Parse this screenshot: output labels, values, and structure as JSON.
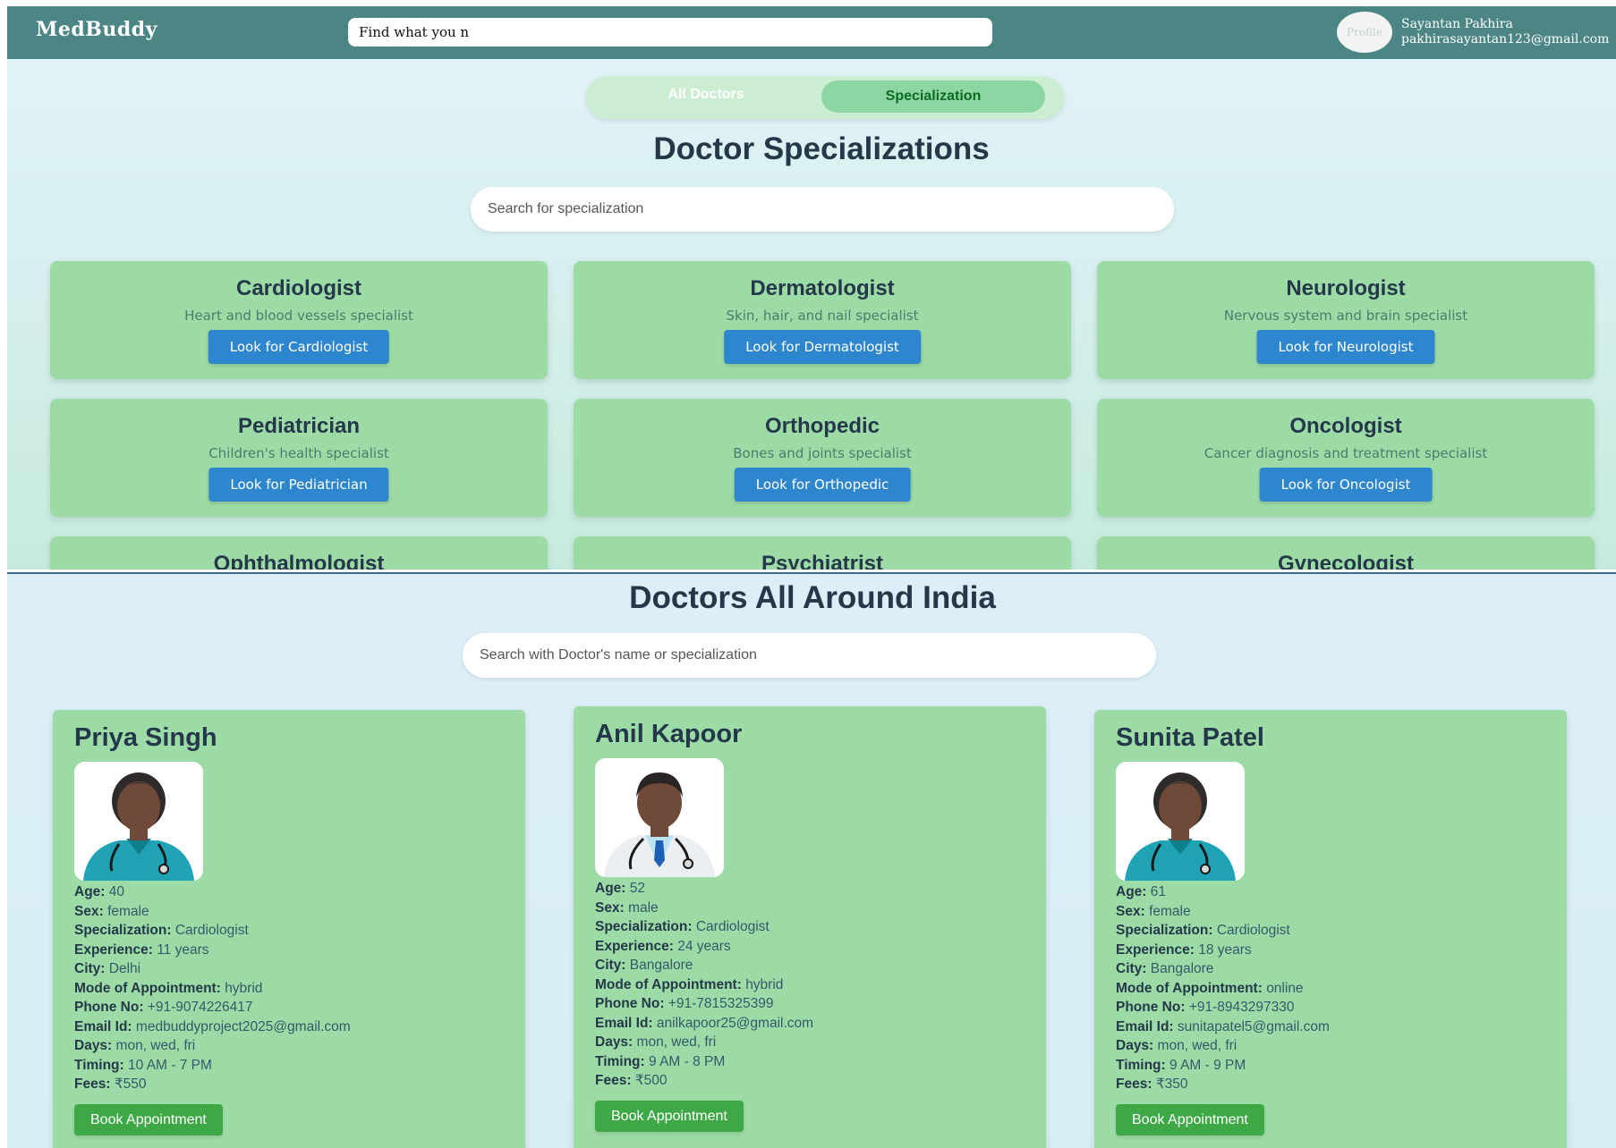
{
  "navbar": {
    "brand": "MedBuddy",
    "search_value": "Find what you n",
    "avatar_alt": "Profile",
    "user_name": "Sayantan Pakhira",
    "user_email": "pakhirasayantan123@gmail.com"
  },
  "specializations_page": {
    "toggle": {
      "all_doctors": "All Doctors",
      "specialization": "Specialization"
    },
    "title": "Doctor Specializations",
    "search_placeholder": "Search for specialization",
    "cards": [
      {
        "name": "Cardiologist",
        "description": "Heart and blood vessels specialist",
        "button": "Look for Cardiologist"
      },
      {
        "name": "Dermatologist",
        "description": "Skin, hair, and nail specialist",
        "button": "Look for Dermatologist"
      },
      {
        "name": "Neurologist",
        "description": "Nervous system and brain specialist",
        "button": "Look for Neurologist"
      },
      {
        "name": "Pediatrician",
        "description": "Children's health specialist",
        "button": "Look for Pediatrician"
      },
      {
        "name": "Orthopedic",
        "description": "Bones and joints specialist",
        "button": "Look for Orthopedic"
      },
      {
        "name": "Oncologist",
        "description": "Cancer diagnosis and treatment specialist",
        "button": "Look for Oncologist"
      },
      {
        "name": "Ophthalmologist"
      },
      {
        "name": "Psychiatrist"
      },
      {
        "name": "Gynecologist"
      }
    ]
  },
  "doctors_page": {
    "title": "Doctors All Around India",
    "search_placeholder": "Search with Doctor's name or specialization",
    "labels": {
      "age": "Age:",
      "sex": "Sex:",
      "specialization": "Specialization:",
      "experience": "Experience:",
      "city": "City:",
      "mode": "Mode of Appointment:",
      "phone": "Phone No:",
      "email": "Email Id:",
      "days": "Days:",
      "timing": "Timing:",
      "fees": "Fees:"
    },
    "book_label": "Book Appointment",
    "doctors": [
      {
        "name": "Priya Singh",
        "avatar": "female-doctor-icon",
        "age": "40",
        "sex": "female",
        "specialization": "Cardiologist",
        "experience": "11 years",
        "city": "Delhi",
        "mode": "hybrid",
        "phone": "+91-9074226417",
        "email": "medbuddyproject2025@gmail.com",
        "days": "mon, wed, fri",
        "timing": "10 AM - 7 PM",
        "fees": "₹550"
      },
      {
        "name": "Anil Kapoor",
        "avatar": "male-doctor-icon",
        "age": "52",
        "sex": "male",
        "specialization": "Cardiologist",
        "experience": "24 years",
        "city": "Bangalore",
        "mode": "hybrid",
        "phone": "+91-7815325399",
        "email": "anilkapoor25@gmail.com",
        "days": "mon, wed, fri",
        "timing": "9 AM - 8 PM",
        "fees": "₹500"
      },
      {
        "name": "Sunita Patel",
        "avatar": "female-doctor-icon",
        "age": "61",
        "sex": "female",
        "specialization": "Cardiologist",
        "experience": "18 years",
        "city": "Bangalore",
        "mode": "online",
        "phone": "+91-8943297330",
        "email": "sunitapatel5@gmail.com",
        "days": "mon, wed, fri",
        "timing": "9 AM - 9 PM",
        "fees": "₹350"
      }
    ]
  },
  "colors": {
    "navbar": "#4b8584",
    "card": "#9ddba6",
    "look_button": "#2e86cf",
    "book_button": "#3ea847",
    "heading": "#24384a"
  }
}
